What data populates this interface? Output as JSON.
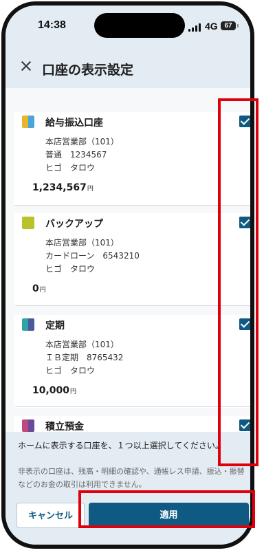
{
  "status": {
    "time": "14:38",
    "network": "4G",
    "battery": "67"
  },
  "header": {
    "title": "口座の表示設定"
  },
  "accounts": [
    {
      "name": "給与振込口座",
      "branch": "本店営業部（101）",
      "type_number": "普通　1234567",
      "holder": "ヒゴ　タロウ",
      "amount": "1,234,567",
      "currency": "円",
      "checked": true,
      "colors": [
        "#e8b62c",
        "#4aa6d8"
      ]
    },
    {
      "name": "バックアップ",
      "branch": "本店営業部（101）",
      "type_number": "カードローン　6543210",
      "holder": "ヒゴ　タロウ",
      "amount": "0",
      "currency": "円",
      "checked": true,
      "colors": [
        "#b9c22b"
      ]
    },
    {
      "name": "定期",
      "branch": "本店営業部（101）",
      "type_number": "ＩＢ定期　8765432",
      "holder": "ヒゴ　タロウ",
      "amount": "10,000",
      "currency": "円",
      "checked": true,
      "colors": [
        "#2ea4a6",
        "#4a5a9c"
      ]
    },
    {
      "name": "積立預金",
      "checked": true,
      "colors": [
        "#c2477e",
        "#6a4a9c"
      ]
    }
  ],
  "footer": {
    "notice": "ホームに表示する口座を、１つ以上選択してください。",
    "note": "非表示の口座は、残高・明細の確認や、通帳レス申請、振込・振替などのお金の取引は利用できません。",
    "cancel_label": "キャンセル",
    "apply_label": "適用"
  },
  "colors": {
    "accent": "#0f5a82",
    "highlight": "#e0000b"
  }
}
